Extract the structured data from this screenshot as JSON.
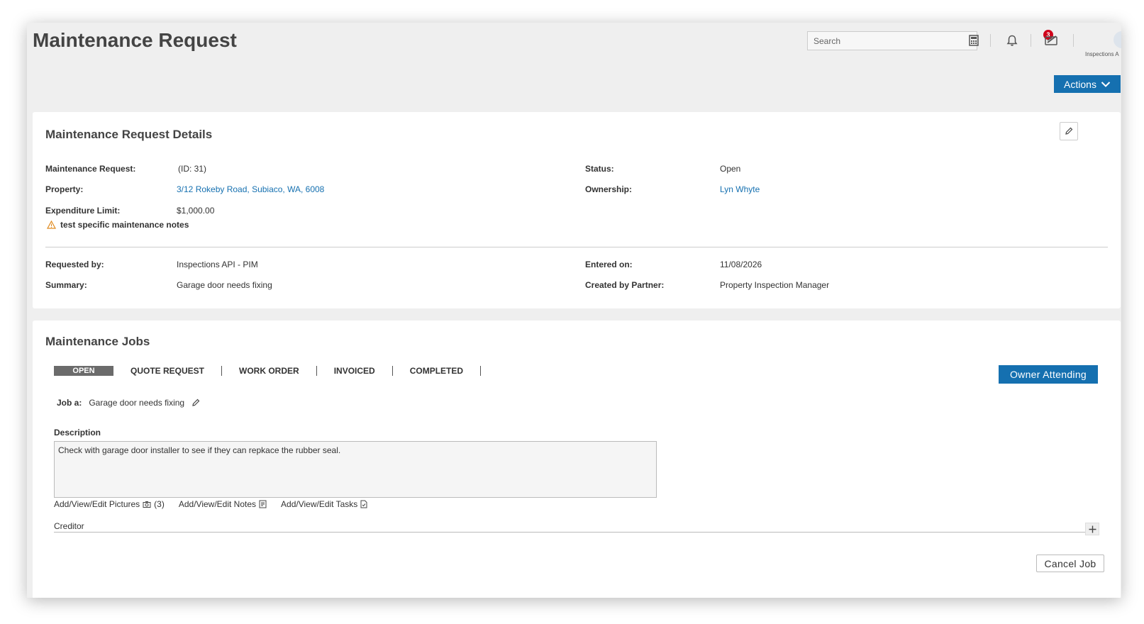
{
  "header": {
    "title": "Maintenance Request",
    "search_placeholder": "Search",
    "notification_count": "3",
    "inspections_label": "Inspections A",
    "actions_label": "Actions"
  },
  "details": {
    "title": "Maintenance Request Details",
    "fields": {
      "maintenance_request_label": "Maintenance Request:",
      "maintenance_request_value": "(ID: 31)",
      "status_label": "Status:",
      "status_value": "Open",
      "property_label": "Property:",
      "property_value": "3/12 Rokeby Road, Subiaco, WA, 6008",
      "ownership_label": "Ownership:",
      "ownership_value": "Lyn Whyte",
      "expenditure_label": "Expenditure Limit:",
      "expenditure_value": "$1,000.00",
      "warning_note": "test specific maintenance notes",
      "requested_by_label": "Requested by:",
      "requested_by_value": "Inspections API - PIM",
      "entered_on_label": "Entered on:",
      "entered_on_value": "11/08/2026",
      "summary_label": "Summary:",
      "summary_value": "Garage door needs fixing",
      "created_by_label": "Created by Partner:",
      "created_by_value": "Property Inspection Manager"
    }
  },
  "jobs": {
    "title": "Maintenance Jobs",
    "tabs": [
      {
        "label": "OPEN",
        "active": true
      },
      {
        "label": "QUOTE REQUEST",
        "active": false
      },
      {
        "label": "WORK ORDER",
        "active": false
      },
      {
        "label": "INVOICED",
        "active": false
      },
      {
        "label": "COMPLETED",
        "active": false
      }
    ],
    "owner_attending_label": "Owner Attending",
    "job_label": "Job a:",
    "job_value": "Garage door needs fixing",
    "description_label": "Description",
    "description_value": "Check with garage door installer to see if they can repkace the rubber seal.",
    "pictures_link": "Add/View/Edit Pictures",
    "pictures_count": "(3)",
    "notes_link": "Add/View/Edit Notes",
    "tasks_link": "Add/View/Edit Tasks",
    "creditor_label": "Creditor",
    "cancel_job_label": "Cancel Job"
  },
  "colors": {
    "accent": "#1570b0",
    "badge": "#d0021b",
    "warning": "#e08a1e"
  }
}
